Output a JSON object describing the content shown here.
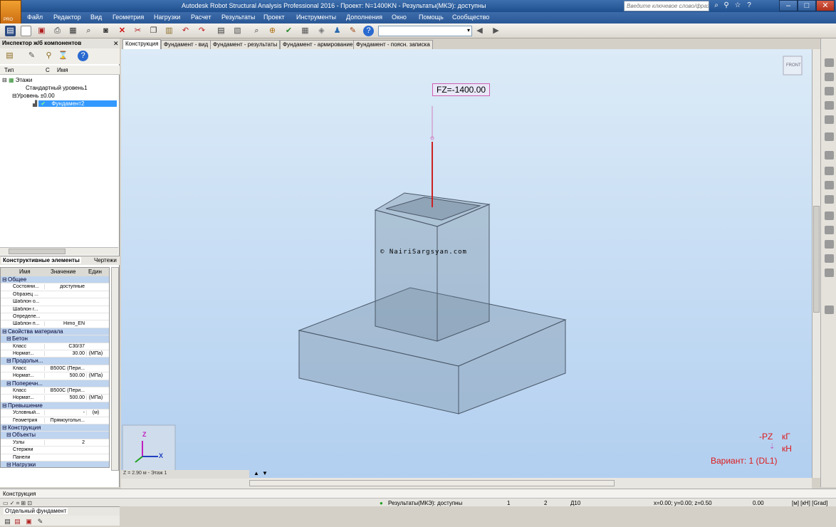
{
  "window": {
    "title": "Autodesk Robot Structural Analysis Professional 2016 - Проект: N=1400KN - Результаты(МКЭ): доступны",
    "search_placeholder": "Введите ключевое слово/фразу",
    "logo_text": "PRO"
  },
  "menu": [
    "Файл",
    "Редактор",
    "Вид",
    "Геометрия",
    "Нагрузки",
    "Расчет",
    "Результаты",
    "Проект",
    "Инструменты",
    "Дополнения",
    "Окно",
    "Помощь",
    "Сообщество"
  ],
  "inspector": {
    "title": "Инспектор ж/б компонентов",
    "columns": {
      "type": "Тип",
      "c": "С",
      "name": "Имя"
    },
    "tree": {
      "root": "Этажи",
      "level_std": "Стандартный уровень1",
      "level_0": "Уровень ±0.00",
      "selected": "Фундамент2"
    },
    "tabs": [
      "Конструктивные элементы",
      "Чертежи"
    ],
    "bottom_tabs": [
      "Отдельный фундамент"
    ]
  },
  "properties": {
    "headers": {
      "name": "Имя",
      "value": "Значение",
      "unit": "Един"
    },
    "rows": [
      {
        "group": "Общее"
      },
      {
        "name": "Состояни...",
        "value": "доступные",
        "unit": ""
      },
      {
        "name": "Образец ...",
        "value": "",
        "unit": ""
      },
      {
        "name": "Шаблон о...",
        "value": "",
        "unit": ""
      },
      {
        "name": "Шаблон г...",
        "value": "",
        "unit": ""
      },
      {
        "name": "Определе...",
        "value": "",
        "unit": ""
      },
      {
        "name": "Шаблон п...",
        "value": "Himo_EN",
        "unit": ""
      },
      {
        "group": "Свойства материала"
      },
      {
        "subgroup": "Бетон"
      },
      {
        "name": "Класс",
        "value": "C30/37",
        "unit": ""
      },
      {
        "name": "Нормат...",
        "value": "30.00",
        "unit": "(МПа)"
      },
      {
        "subgroup": "Продольн..."
      },
      {
        "name": "Класс",
        "value": "B500C (Пери...",
        "unit": ""
      },
      {
        "name": "Нормат...",
        "value": "500.00",
        "unit": "(МПа)"
      },
      {
        "subgroup": "Поперечн..."
      },
      {
        "name": "Класс",
        "value": "B500C (Пери...",
        "unit": ""
      },
      {
        "name": "Нормат...",
        "value": "500.00",
        "unit": "(МПа)"
      },
      {
        "group": "Превышение"
      },
      {
        "name": "Условный...",
        "value": "-",
        "unit": "(м)"
      },
      {
        "name": "Геометрия",
        "value": "Прямоугольн...",
        "unit": ""
      },
      {
        "group": "Конструкция"
      },
      {
        "subgroup": "Объекты"
      },
      {
        "name": "Узлы",
        "value": "2",
        "unit": ""
      },
      {
        "name": "Стержни",
        "value": "",
        "unit": ""
      },
      {
        "name": "Панели",
        "value": "",
        "unit": ""
      },
      {
        "subgroup": "Нагрузки"
      }
    ]
  },
  "view_tabs": [
    "Конструкция",
    "Фундамент - вид",
    "Фундамент - результаты",
    "Фундамент - армирование",
    "Фундамент - поясн. записка"
  ],
  "viewport": {
    "load_label": "FZ=-1400.00",
    "watermark": "© NairiSargsyan.com",
    "cube_label": "FRONT",
    "axis_z": "Z",
    "axis_x": "X",
    "legend": {
      "pz": "-PZ",
      "kg": "кГ",
      "kn": "кН",
      "variant": "Вариант: 1 (DL1)"
    },
    "z_info": "Z = 2.90 м - Этаж 1",
    "accent": "#dd1a1a"
  },
  "status": {
    "view_name": "Конструкция",
    "results": "Результаты(МКЭ): доступны",
    "n1": "1",
    "n2": "2",
    "d": "Д10",
    "coords": "x=0.00; y=0.00; z=0.50",
    "val": "0.00",
    "units": "[м] [кН] [Grad]"
  }
}
